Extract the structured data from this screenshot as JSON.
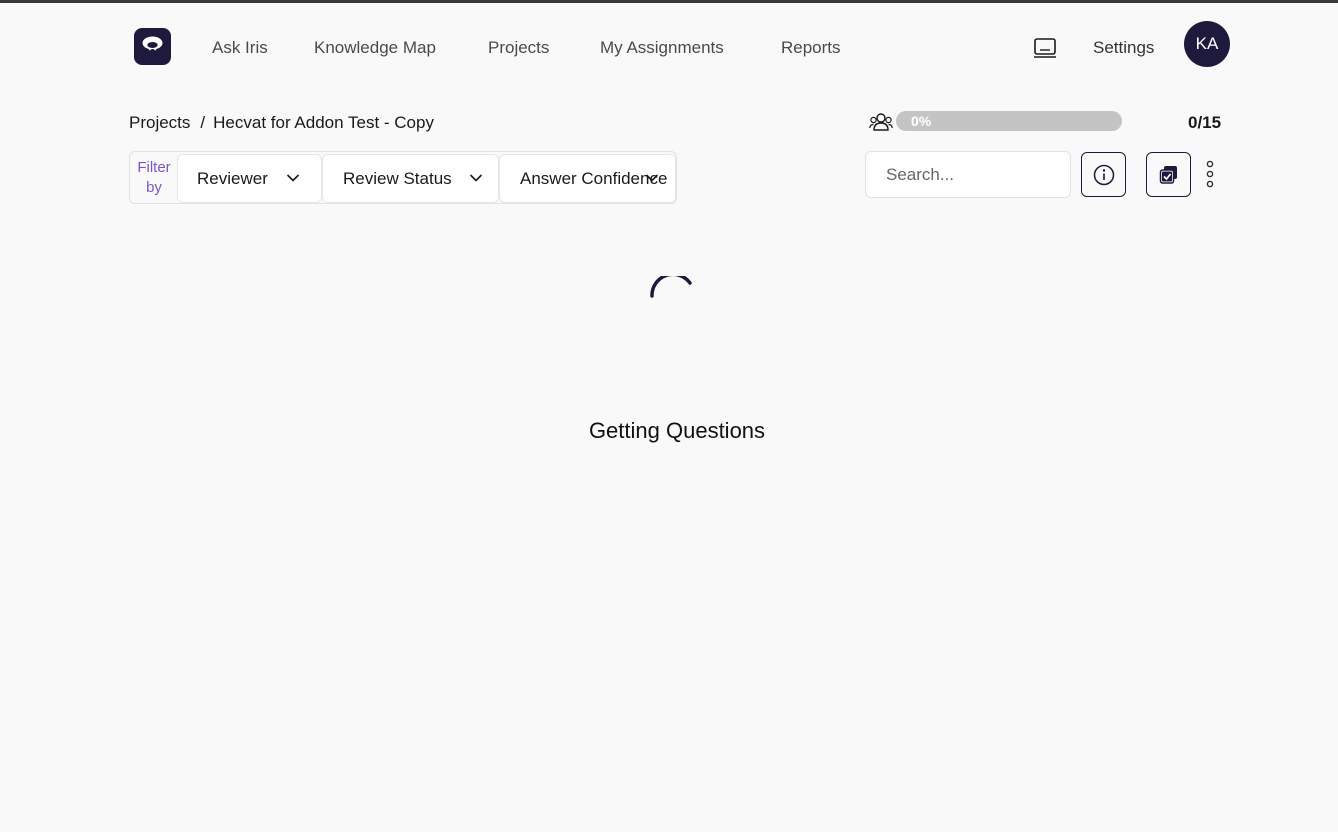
{
  "nav": {
    "items": [
      {
        "label": "Ask Iris"
      },
      {
        "label": "Knowledge Map"
      },
      {
        "label": "Projects"
      },
      {
        "label": "My Assignments"
      },
      {
        "label": "Reports"
      }
    ],
    "settings_label": "Settings",
    "avatar_initials": "KA",
    "logo_icon": "iris-logo-icon",
    "screen_icon": "laptop-icon"
  },
  "breadcrumb": {
    "root": "Projects",
    "separator": "/",
    "current": "Hecvat for Addon Test - Copy"
  },
  "progress": {
    "fraction": 0,
    "percent_label": "0%",
    "count_label": "0/15",
    "icon": "people-icon"
  },
  "filters": {
    "label": "Filter by",
    "dropdowns": [
      {
        "label": "Reviewer"
      },
      {
        "label": "Review Status"
      },
      {
        "label": "Answer Confidence"
      }
    ]
  },
  "search": {
    "placeholder": "Search...",
    "value": ""
  },
  "actions": {
    "info_icon": "info-icon",
    "copy_icon": "copy-check-icon",
    "more_icon": "more-vertical-icon"
  },
  "loading": {
    "text": "Getting Questions"
  },
  "colors": {
    "brand": "#1e1a3d",
    "accent": "#7b54c9",
    "background": "#f9f9f9",
    "progress_track": "#c4c4c4"
  }
}
